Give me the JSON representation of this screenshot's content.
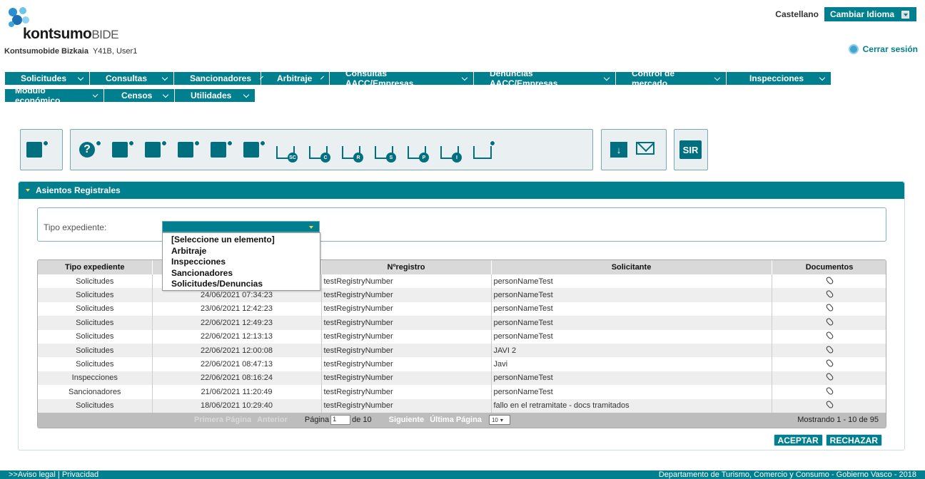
{
  "header": {
    "logo_bold": "kontsumo",
    "logo_light": "BIDE",
    "org": "Kontsumobide Bizkaia",
    "user": "Y41B, User1",
    "lang_current": "Castellano",
    "lang_button": "Cambiar Idioma",
    "logout": "Cerrar sesión"
  },
  "menu": {
    "row1": [
      "Solicitudes",
      "Consultas",
      "Sancionadores",
      "Arbitraje",
      "Consultas AACC/Empresas",
      "Denuncias AACC/Empresas",
      "Control de mercado",
      "Inspecciones"
    ],
    "row2": [
      "Módulo económico",
      "Censos",
      "Utilidades"
    ]
  },
  "toolbar": {
    "trays": [
      "SC",
      "C",
      "R",
      "S",
      "P",
      "I"
    ],
    "sir": "SIR"
  },
  "panel": {
    "title": "Asientos Registrales",
    "filter_label": "Tipo expediente:",
    "dropdown_options": [
      "[Seleccione un elemento]",
      "Arbitraje",
      "Inspecciones",
      "Sancionadores",
      "Solicitudes/Denuncias"
    ]
  },
  "table": {
    "headers": [
      "Tipo expediente",
      "",
      "Nºregistro",
      "Solicitante",
      "Documentos"
    ],
    "rows": [
      [
        "Solicitudes",
        "",
        "testRegistryNumber",
        "personNameTest"
      ],
      [
        "Solicitudes",
        "24/06/2021 07:34:23",
        "testRegistryNumber",
        "personNameTest"
      ],
      [
        "Solicitudes",
        "23/06/2021 12:42:23",
        "testRegistryNumber",
        "personNameTest"
      ],
      [
        "Solicitudes",
        "22/06/2021 12:49:23",
        "testRegistryNumber",
        "personNameTest"
      ],
      [
        "Solicitudes",
        "22/06/2021 12:13:13",
        "testRegistryNumber",
        "personNameTest"
      ],
      [
        "Solicitudes",
        "22/06/2021 12:00:08",
        "testRegistryNumber",
        "JAVI 2"
      ],
      [
        "Solicitudes",
        "22/06/2021 08:47:13",
        "testRegistryNumber",
        "Javi"
      ],
      [
        "Inspecciones",
        "22/06/2021 08:16:24",
        "testRegistryNumber",
        "personNameTest"
      ],
      [
        "Sancionadores",
        "21/06/2021 11:20:49",
        "testRegistryNumber",
        "personNameTest"
      ],
      [
        "Solicitudes",
        "18/06/2021 10:29:40",
        "testRegistryNumber",
        "fallo en el retramitate - docs tramitados"
      ]
    ]
  },
  "pager": {
    "first": "Primera Página",
    "prev": "Anterior",
    "page_label": "Página",
    "page_value": "1",
    "of": "de 10",
    "next": "Siguiente",
    "last": "Última Página",
    "size": "10",
    "showing": "Mostrando 1 - 10 de 95"
  },
  "actions": {
    "accept": "ACEPTAR",
    "reject": "RECHAZAR"
  },
  "footer": {
    "left": ">>Aviso legal  |  Privacidad",
    "right": "Departamento de Turismo, Comercio y Consumo - Gobierno Vasco - 2018"
  },
  "colors": {
    "brand": "#007f8f",
    "accent": "#ffd24d"
  }
}
